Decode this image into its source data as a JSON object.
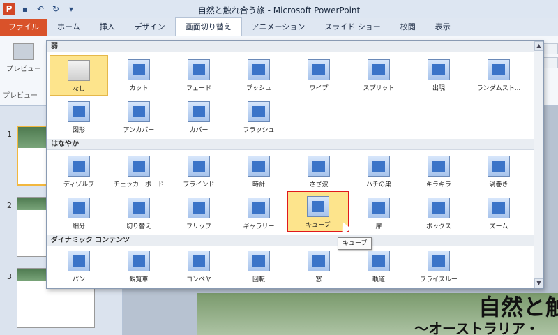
{
  "window": {
    "title": "自然と触れ合う旅 - Microsoft PowerPoint",
    "app_icon": "P"
  },
  "qat": {
    "save_icon": "save-icon",
    "undo_icon": "undo-icon",
    "redo_icon": "redo-icon"
  },
  "tabs": [
    {
      "label": "ファイル"
    },
    {
      "label": "ホーム"
    },
    {
      "label": "挿入"
    },
    {
      "label": "デザイン"
    },
    {
      "label": "画面切り替え"
    },
    {
      "label": "アニメーション"
    },
    {
      "label": "スライド ショー"
    },
    {
      "label": "校閲"
    },
    {
      "label": "表示"
    }
  ],
  "ribbon": {
    "preview_label": "プレビュー",
    "preview_group": "プレビュー"
  },
  "gallery": {
    "sections": [
      {
        "label": "弱",
        "items": [
          "なし",
          "カット",
          "フェード",
          "プッシュ",
          "ワイプ",
          "スプリット",
          "出現",
          "ランダムスト...",
          "図形",
          "アンカバー",
          "カバー",
          "フラッシュ"
        ]
      },
      {
        "label": "はなやか",
        "items": [
          "ディゾルブ",
          "チェッカーボード",
          "ブラインド",
          "時計",
          "さざ波",
          "ハチの巣",
          "キラキラ",
          "渦巻き",
          "細分",
          "切り替え",
          "フリップ",
          "ギャラリー",
          "キューブ",
          "扉",
          "ボックス",
          "ズーム"
        ]
      },
      {
        "label": "ダイナミック コンテンツ",
        "items": [
          "パン",
          "観覧車",
          "コンベヤ",
          "回転",
          "窓",
          "軌道",
          "フライスルー"
        ]
      }
    ],
    "tooltip": "キューブ"
  },
  "slides": [
    {
      "number": "1"
    },
    {
      "number": "2"
    },
    {
      "number": "3"
    }
  ],
  "slide": {
    "title": "自然と触",
    "subtitle": "～オーストラリア・"
  }
}
